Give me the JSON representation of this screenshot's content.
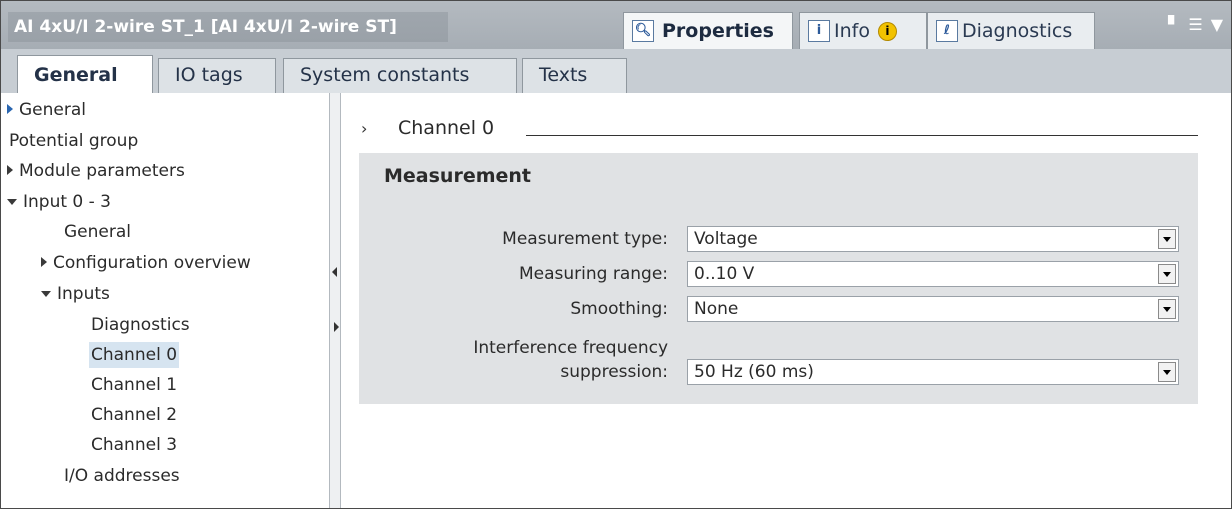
{
  "window": {
    "title": "AI 4xU/I 2-wire ST_1 [AI 4xU/I 2-wire ST]",
    "tabs": [
      {
        "label": "Properties",
        "icon": "properties-icon"
      },
      {
        "label": "Info",
        "icon": "info-icon"
      },
      {
        "label": "Diagnostics",
        "icon": "diagnostics-icon"
      }
    ],
    "info_badge": "i"
  },
  "subtabs": [
    "General",
    "IO tags",
    "System constants",
    "Texts"
  ],
  "nav": {
    "items": [
      {
        "label": "General"
      },
      {
        "label": "Potential group"
      },
      {
        "label": "Module parameters"
      },
      {
        "label": "Input 0 - 3"
      },
      {
        "label": "General"
      },
      {
        "label": "Configuration overview"
      },
      {
        "label": "Inputs"
      },
      {
        "label": "Diagnostics"
      },
      {
        "label": "Channel 0"
      },
      {
        "label": "Channel 1"
      },
      {
        "label": "Channel 2"
      },
      {
        "label": "Channel 3"
      },
      {
        "label": "I/O addresses"
      }
    ]
  },
  "main": {
    "section_chevron": "›",
    "section_title": "Channel 0",
    "group_title": "Measurement",
    "fields": [
      {
        "label": "Measurement type:",
        "value": "Voltage"
      },
      {
        "label": "Measuring range:",
        "value": "0..10 V"
      },
      {
        "label": "Smoothing:",
        "value": "None"
      },
      {
        "label_line1": "Interference frequency",
        "label_line2": "suppression:",
        "value": "50 Hz (60 ms)"
      }
    ]
  }
}
